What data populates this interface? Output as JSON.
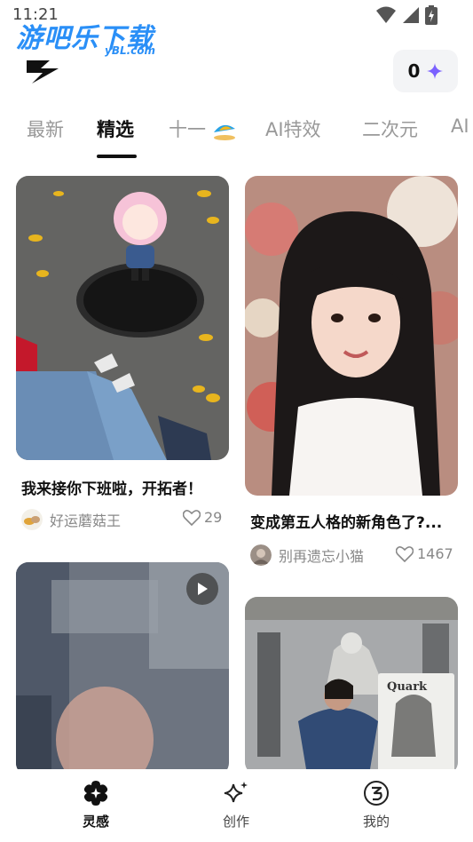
{
  "status_bar": {
    "time": "11:21"
  },
  "watermark": {
    "main": "游吧乐下载",
    "sub": "yBL.com"
  },
  "header": {
    "credit_count": "0"
  },
  "tabs": [
    {
      "label": "最新"
    },
    {
      "label": "精选"
    },
    {
      "label": "十一"
    },
    {
      "label": "AI特效"
    },
    {
      "label": "二次元"
    },
    {
      "label": "AI"
    }
  ],
  "feed": {
    "cards": [
      {
        "title": "我来接你下班啦，开拓者！",
        "author": "好运蘑菇王",
        "likes": "29"
      },
      {
        "title": "变成第五人格的新角色了?...",
        "author": "别再遗忘小猫",
        "likes": "1467"
      }
    ]
  },
  "bottom_nav": {
    "items": [
      {
        "label": "灵感"
      },
      {
        "label": "创作"
      },
      {
        "label": "我的"
      }
    ]
  },
  "colors": {
    "accent_sparkle": "#7b61ff",
    "active_text": "#111111",
    "inactive_text": "#999999"
  }
}
